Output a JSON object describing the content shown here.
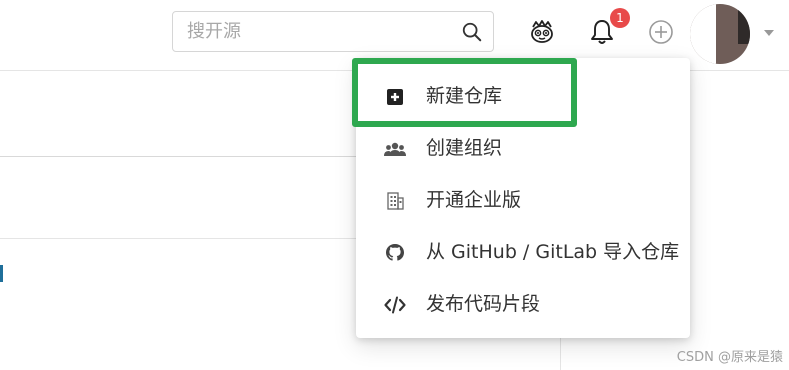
{
  "search": {
    "placeholder": "搜开源",
    "value": ""
  },
  "header": {
    "notification_count": "1",
    "icons": [
      "search-icon",
      "mascot-icon",
      "bell-icon",
      "plus-circle-icon",
      "caret-down-icon"
    ]
  },
  "create_menu": {
    "items": [
      {
        "label": "新建仓库",
        "icon": "plus-square-icon"
      },
      {
        "label": "创建组织",
        "icon": "users-icon"
      },
      {
        "label": "开通企业版",
        "icon": "building-icon"
      },
      {
        "label": "从 GitHub / GitLab 导入仓库",
        "icon": "github-icon"
      },
      {
        "label": "发布代码片段",
        "icon": "code-icon"
      }
    ]
  },
  "colors": {
    "highlight": "#2ea84f",
    "badge": "#e84a4a"
  },
  "watermark": "CSDN @原来是猿"
}
